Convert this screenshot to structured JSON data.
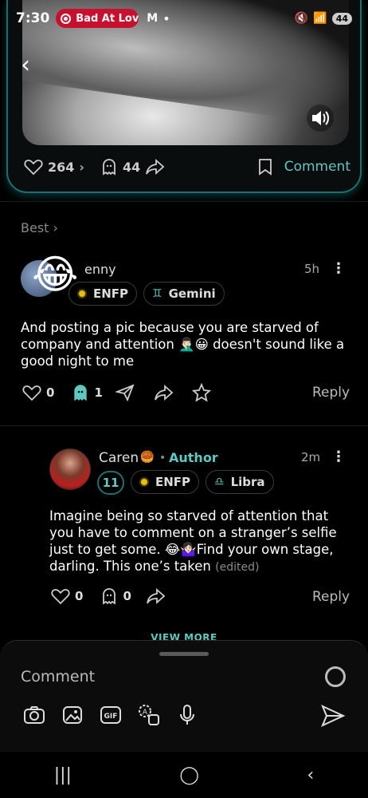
{
  "status": {
    "time": "7:30",
    "music": "Bad At Lov",
    "mail": "M",
    "dot": "•",
    "battery": "44"
  },
  "post": {
    "likes": "264",
    "ghosts": "44",
    "comment_label": "Comment"
  },
  "sort": {
    "label": "Best ›"
  },
  "comment1": {
    "username": "enny",
    "time": "5h",
    "chips": [
      "ENFP",
      "Gemini"
    ],
    "text": "And posting a pic because you are starved of company and attention 🤦🏻‍♂️😀 doesn't sound like a good night to me",
    "likes": "0",
    "ghosts": "1",
    "reply": "Reply"
  },
  "reply1": {
    "username": "Caren",
    "author_badge": "Author",
    "time": "2m",
    "level": "11",
    "chips": [
      "ENFP",
      "Libra"
    ],
    "text": "Imagine being so starved of attention that you have to comment on a stranger’s selfie just to get some. 😂🤷🏻‍♀️Find your own stage, darling. This one’s taken",
    "edited": "(edited)",
    "likes": "0",
    "ghosts": "0",
    "reply": "Reply"
  },
  "view_more": "VIEW MORE",
  "composer": {
    "placeholder": "Comment"
  },
  "colors": {
    "accent": "#5fc8c0",
    "pill": "#c8102e",
    "chip_dot": "#e7c000"
  }
}
